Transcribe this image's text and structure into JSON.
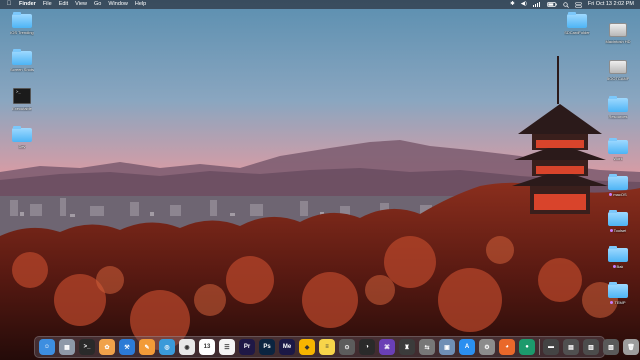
{
  "menubar": {
    "apple_icon": "apple-logo-icon",
    "app_name": "Finder",
    "items": [
      "File",
      "Edit",
      "View",
      "Go",
      "Window",
      "Help"
    ],
    "status_icons": [
      "bluetooth-icon",
      "volume-icon",
      "wifi-icon",
      "battery-icon",
      "search-icon",
      "control-center-icon"
    ],
    "clock": "Fri Oct 13  2:02 PM"
  },
  "desktop_left": [
    {
      "type": "folder",
      "label": "iOS Trending"
    },
    {
      "type": "folder",
      "label": "Screen Shots"
    },
    {
      "type": "terminal",
      "label": "Executable"
    },
    {
      "type": "folder",
      "label": "Dev"
    }
  ],
  "desktop_right": [
    {
      "type": "folder",
      "label": "SDCardFolder"
    },
    {
      "type": "drive",
      "label": "Macintosh HD"
    },
    {
      "type": "drive",
      "label": "BOOTCAMP"
    },
    {
      "type": "folder",
      "label": "Resources"
    },
    {
      "type": "folder",
      "label": "Work"
    },
    {
      "type": "folder",
      "label": "macOS",
      "tag": "#c77dff"
    },
    {
      "type": "folder",
      "label": "Toolset",
      "tag": "#c77dff"
    },
    {
      "type": "folder",
      "label": "Bak",
      "tag": "#c77dff"
    },
    {
      "type": "folder",
      "label": "TEMP",
      "tag": "#c77dff"
    }
  ],
  "dock": {
    "apps": [
      {
        "name": "finder-icon",
        "glyph": "☺",
        "color": "#3d8ee0"
      },
      {
        "name": "launchpad-icon",
        "glyph": "▦",
        "color": "#8e99a8"
      },
      {
        "name": "terminal-icon",
        "glyph": ">_",
        "color": "#2a2a2a"
      },
      {
        "name": "photos-icon",
        "glyph": "✿",
        "color": "#f0a24a"
      },
      {
        "name": "xcode-icon",
        "glyph": "⚒",
        "color": "#2c7bd6"
      },
      {
        "name": "pages-icon",
        "glyph": "✎",
        "color": "#f29b38"
      },
      {
        "name": "safari-icon",
        "glyph": "◎",
        "color": "#3a9ad9"
      },
      {
        "name": "chrome-icon",
        "glyph": "◉",
        "color": "#e8e8e8"
      },
      {
        "name": "calendar-icon",
        "glyph": "13",
        "color": "#ffffff"
      },
      {
        "name": "reminders-icon",
        "glyph": "☰",
        "color": "#f4f4f4"
      },
      {
        "name": "premiere-pro-icon",
        "glyph": "Pr",
        "color": "#1f1846"
      },
      {
        "name": "photoshop-icon",
        "glyph": "Ps",
        "color": "#0b2440"
      },
      {
        "name": "media-encoder-icon",
        "glyph": "Me",
        "color": "#1b1846"
      },
      {
        "name": "sketch-icon",
        "glyph": "◆",
        "color": "#f7b500"
      },
      {
        "name": "notes-icon",
        "glyph": "≡",
        "color": "#f7d54a"
      },
      {
        "name": "screenshot-icon",
        "glyph": "⊙",
        "color": "#5c5c5c"
      },
      {
        "name": "github-icon",
        "glyph": "◑",
        "color": "#2a2a2a"
      },
      {
        "name": "github-desktop-icon",
        "glyph": "⌘",
        "color": "#6a3fb5"
      },
      {
        "name": "automator-icon",
        "glyph": "♜",
        "color": "#3b3b3b"
      },
      {
        "name": "migration-assistant-icon",
        "glyph": "⇆",
        "color": "#777777"
      },
      {
        "name": "preview-icon",
        "glyph": "▣",
        "color": "#6f8fb5"
      },
      {
        "name": "app-store-icon",
        "glyph": "A",
        "color": "#2b8ff0"
      },
      {
        "name": "system-settings-icon",
        "glyph": "⚙",
        "color": "#8c8c8c"
      },
      {
        "name": "firefox-icon",
        "glyph": "◕",
        "color": "#e9682a"
      },
      {
        "name": "arc-icon",
        "glyph": "●",
        "color": "#1c9a6c"
      }
    ],
    "recent": [
      {
        "name": "recent-window-1-icon",
        "glyph": "▬",
        "color": "#444444"
      },
      {
        "name": "recent-window-2-icon",
        "glyph": "▤",
        "color": "#505050"
      },
      {
        "name": "recent-window-3-icon",
        "glyph": "▥",
        "color": "#4c4c4c"
      },
      {
        "name": "recent-window-4-icon",
        "glyph": "▧",
        "color": "#5a5a5a"
      },
      {
        "name": "trash-icon",
        "glyph": "🗑",
        "color": "#9c9c9c"
      }
    ]
  }
}
